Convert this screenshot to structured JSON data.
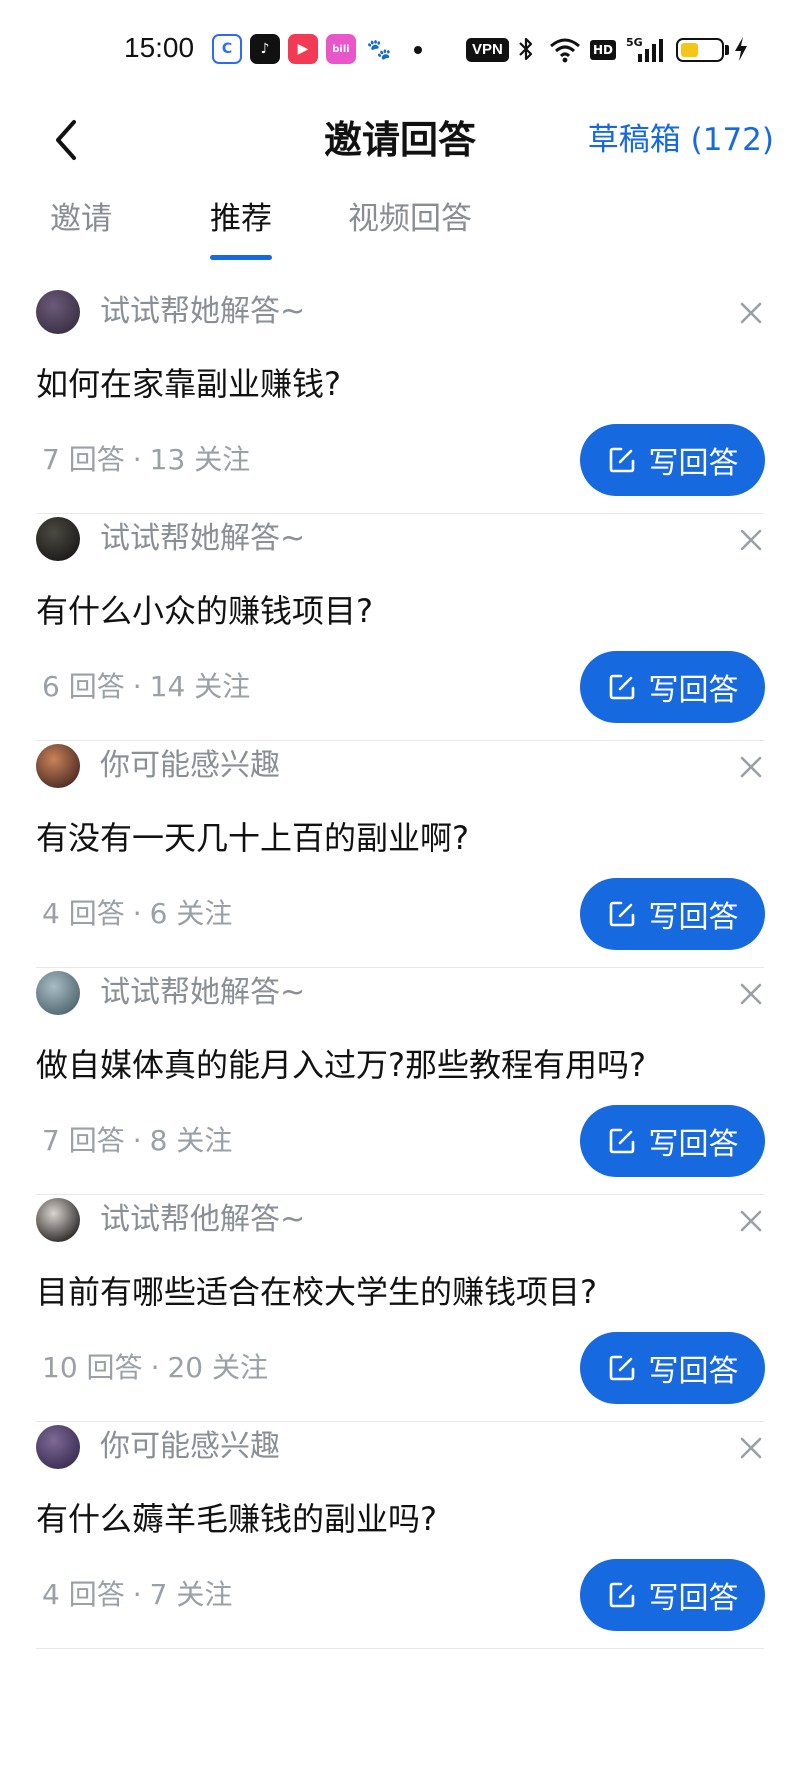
{
  "status_bar": {
    "time": "15:00",
    "vpn_label": "VPN",
    "hd_label": "HD",
    "network_label": "5G",
    "battery_level": 0.45,
    "apps": [
      {
        "name": "browser-app-icon",
        "color": "#2b6cf6"
      },
      {
        "name": "tiktok-app-icon",
        "color": "#111111"
      },
      {
        "name": "video-app-icon",
        "color": "#f23a55"
      },
      {
        "name": "bilibili-app-icon",
        "color": "#e856c9"
      },
      {
        "name": "baidu-app-icon",
        "color": "#2e5bdc"
      }
    ]
  },
  "header": {
    "title": "邀请回答",
    "drafts_label": "草稿箱 (172)"
  },
  "tabs": [
    {
      "label": "邀请",
      "active": false
    },
    {
      "label": "推荐",
      "active": true
    },
    {
      "label": "视频回答",
      "active": false
    }
  ],
  "colors": {
    "accent": "#1769e0",
    "muted_text": "#8a8f96"
  },
  "items": [
    {
      "reason": "试试帮她解答~",
      "question": "如何在家靠副业赚钱?",
      "answers": "7",
      "answers_unit": "回答",
      "followers": "13",
      "followers_unit": "关注",
      "button_label": "写回答",
      "avatar_colors": [
        "#6b5a7a",
        "#3a2f44"
      ]
    },
    {
      "reason": "试试帮她解答~",
      "question": "有什么小众的赚钱项目?",
      "answers": "6",
      "answers_unit": "回答",
      "followers": "14",
      "followers_unit": "关注",
      "button_label": "写回答",
      "avatar_colors": [
        "#4a4a42",
        "#1c1a18"
      ]
    },
    {
      "reason": "你可能感兴趣",
      "question": "有没有一天几十上百的副业啊?",
      "answers": "4",
      "answers_unit": "回答",
      "followers": "6",
      "followers_unit": "关注",
      "button_label": "写回答",
      "avatar_colors": [
        "#c9835a",
        "#4d2a22"
      ]
    },
    {
      "reason": "试试帮她解答~",
      "question": "做自媒体真的能月入过万?那些教程有用吗?",
      "answers": "7",
      "answers_unit": "回答",
      "followers": "8",
      "followers_unit": "关注",
      "button_label": "写回答",
      "avatar_colors": [
        "#a9bcc4",
        "#4f6670"
      ]
    },
    {
      "reason": "试试帮他解答~",
      "question": "目前有哪些适合在校大学生的赚钱项目?",
      "answers": "10",
      "answers_unit": "回答",
      "followers": "20",
      "followers_unit": "关注",
      "button_label": "写回答",
      "avatar_colors": [
        "#d9d4cf",
        "#2a2624"
      ]
    },
    {
      "reason": "你可能感兴趣",
      "question": "有什么薅羊毛赚钱的副业吗?",
      "answers": "4",
      "answers_unit": "回答",
      "followers": "7",
      "followers_unit": "关注",
      "button_label": "写回答",
      "avatar_colors": [
        "#7d6a96",
        "#3b2d52"
      ]
    }
  ]
}
